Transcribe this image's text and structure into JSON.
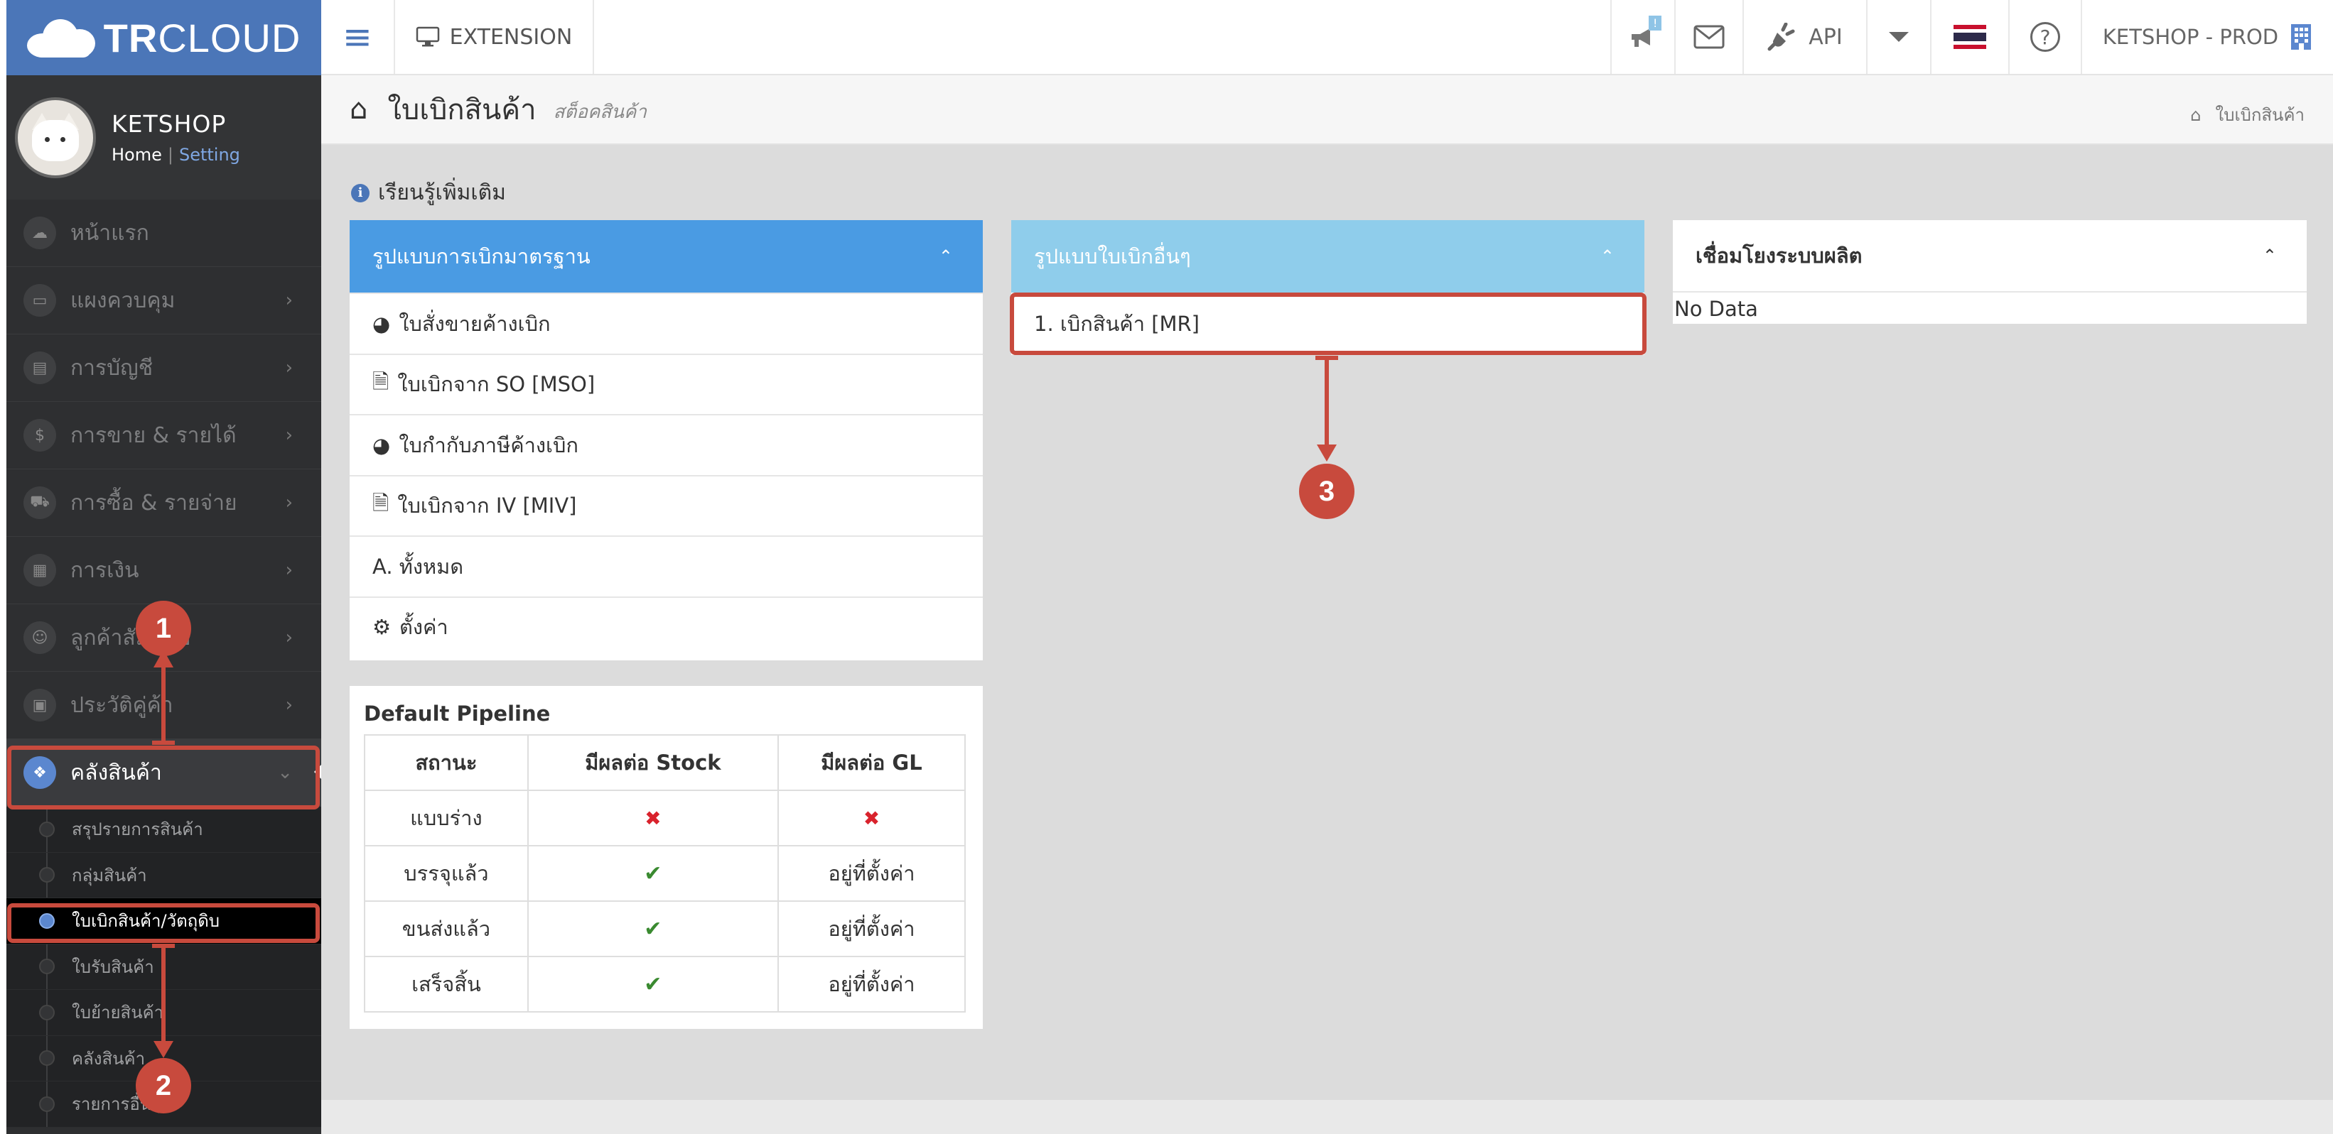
{
  "brand": {
    "logo_bold": "TR",
    "logo_light": "CLOUD"
  },
  "topbar": {
    "extension_label": "EXTENSION",
    "notification_count": "!",
    "api_label": "API",
    "company": "KETSHOP - PROD"
  },
  "user": {
    "name": "KETSHOP",
    "home_link": "Home",
    "separator": "|",
    "setting_link": "Setting"
  },
  "sidebar": {
    "items": [
      {
        "label": "หน้าแรก",
        "icon": "cloud-icon",
        "has_children": false
      },
      {
        "label": "แผงควบคุม",
        "icon": "monitor-icon",
        "has_children": true
      },
      {
        "label": "การบัญชี",
        "icon": "book-icon",
        "has_children": true
      },
      {
        "label": "การขาย & รายได้",
        "icon": "dollar-icon",
        "has_children": true
      },
      {
        "label": "การซื้อ & รายจ่าย",
        "icon": "cart-icon",
        "has_children": true
      },
      {
        "label": "การเงิน",
        "icon": "calendar-icon",
        "has_children": true
      },
      {
        "label": "ลูกค้าสัมพันธ์",
        "icon": "users-icon",
        "has_children": true
      },
      {
        "label": "ประวัติคู่ค้า",
        "icon": "contact-icon",
        "has_children": true
      }
    ],
    "active_item": {
      "label": "คลังสินค้า",
      "icon": "boxes-icon"
    },
    "submenu": [
      {
        "label": "สรุปรายการสินค้า"
      },
      {
        "label": "กลุ่มสินค้า"
      },
      {
        "label": "ใบเบิกสินค้า/วัตถุดิบ",
        "current": true
      },
      {
        "label": "ใบรับสินค้า"
      },
      {
        "label": "ใบย้ายสินค้า"
      },
      {
        "label": "คลังสินค้า"
      },
      {
        "label": "รายการอื่นๆ"
      }
    ]
  },
  "page": {
    "title": "ใบเบิกสินค้า",
    "subtitle": "สต็อคสินค้า",
    "breadcrumb": "ใบเบิกสินค้า",
    "learn_more": "เรียนรู้เพิ่มเติม"
  },
  "standard_panel": {
    "title": "รูปแบบการเบิกมาตรฐาน",
    "rows": [
      {
        "label": "ใบสั่งขายค้างเบิก",
        "icon": "dashboard-icon"
      },
      {
        "label": "ใบเบิกจาก SO [MSO]",
        "icon": "file-icon"
      },
      {
        "label": "ใบกำกับภาษีค้างเบิก",
        "icon": "dashboard-icon"
      },
      {
        "label": "ใบเบิกจาก IV [MIV]",
        "icon": "file-icon"
      },
      {
        "label": "A. ทั้งหมด",
        "icon": ""
      },
      {
        "label": "ตั้งค่า",
        "icon": "gears-icon"
      }
    ]
  },
  "other_panel": {
    "title": "รูปแบบใบเบิกอื่นๆ",
    "rows": [
      {
        "label": "1. เบิกสินค้า [MR]"
      }
    ]
  },
  "production_panel": {
    "title": "เชื่อมโยงระบบผลิต",
    "empty_text": "No Data"
  },
  "pipeline": {
    "title": "Default Pipeline",
    "headers": [
      "สถานะ",
      "มีผลต่อ Stock",
      "มีผลต่อ GL"
    ],
    "rows": [
      {
        "status": "แบบร่าง",
        "stock": "✖",
        "gl": "✖",
        "gl_is_mark": true
      },
      {
        "status": "บรรจุแล้ว",
        "stock": "✔",
        "gl": "อยู่ที่ตั้งค่า",
        "gl_is_mark": false
      },
      {
        "status": "ขนส่งแล้ว",
        "stock": "✔",
        "gl": "อยู่ที่ตั้งค่า",
        "gl_is_mark": false
      },
      {
        "status": "เสร็จสิ้น",
        "stock": "✔",
        "gl": "อยู่ที่ตั้งค่า",
        "gl_is_mark": false
      }
    ]
  },
  "annotations": {
    "badge_1": "1",
    "badge_2": "2",
    "badge_3": "3"
  },
  "colors": {
    "accent": "#4b76b8",
    "annotation": "#c84a3d",
    "standard_header": "#4a9be3",
    "other_header": "#8fcdeb"
  }
}
